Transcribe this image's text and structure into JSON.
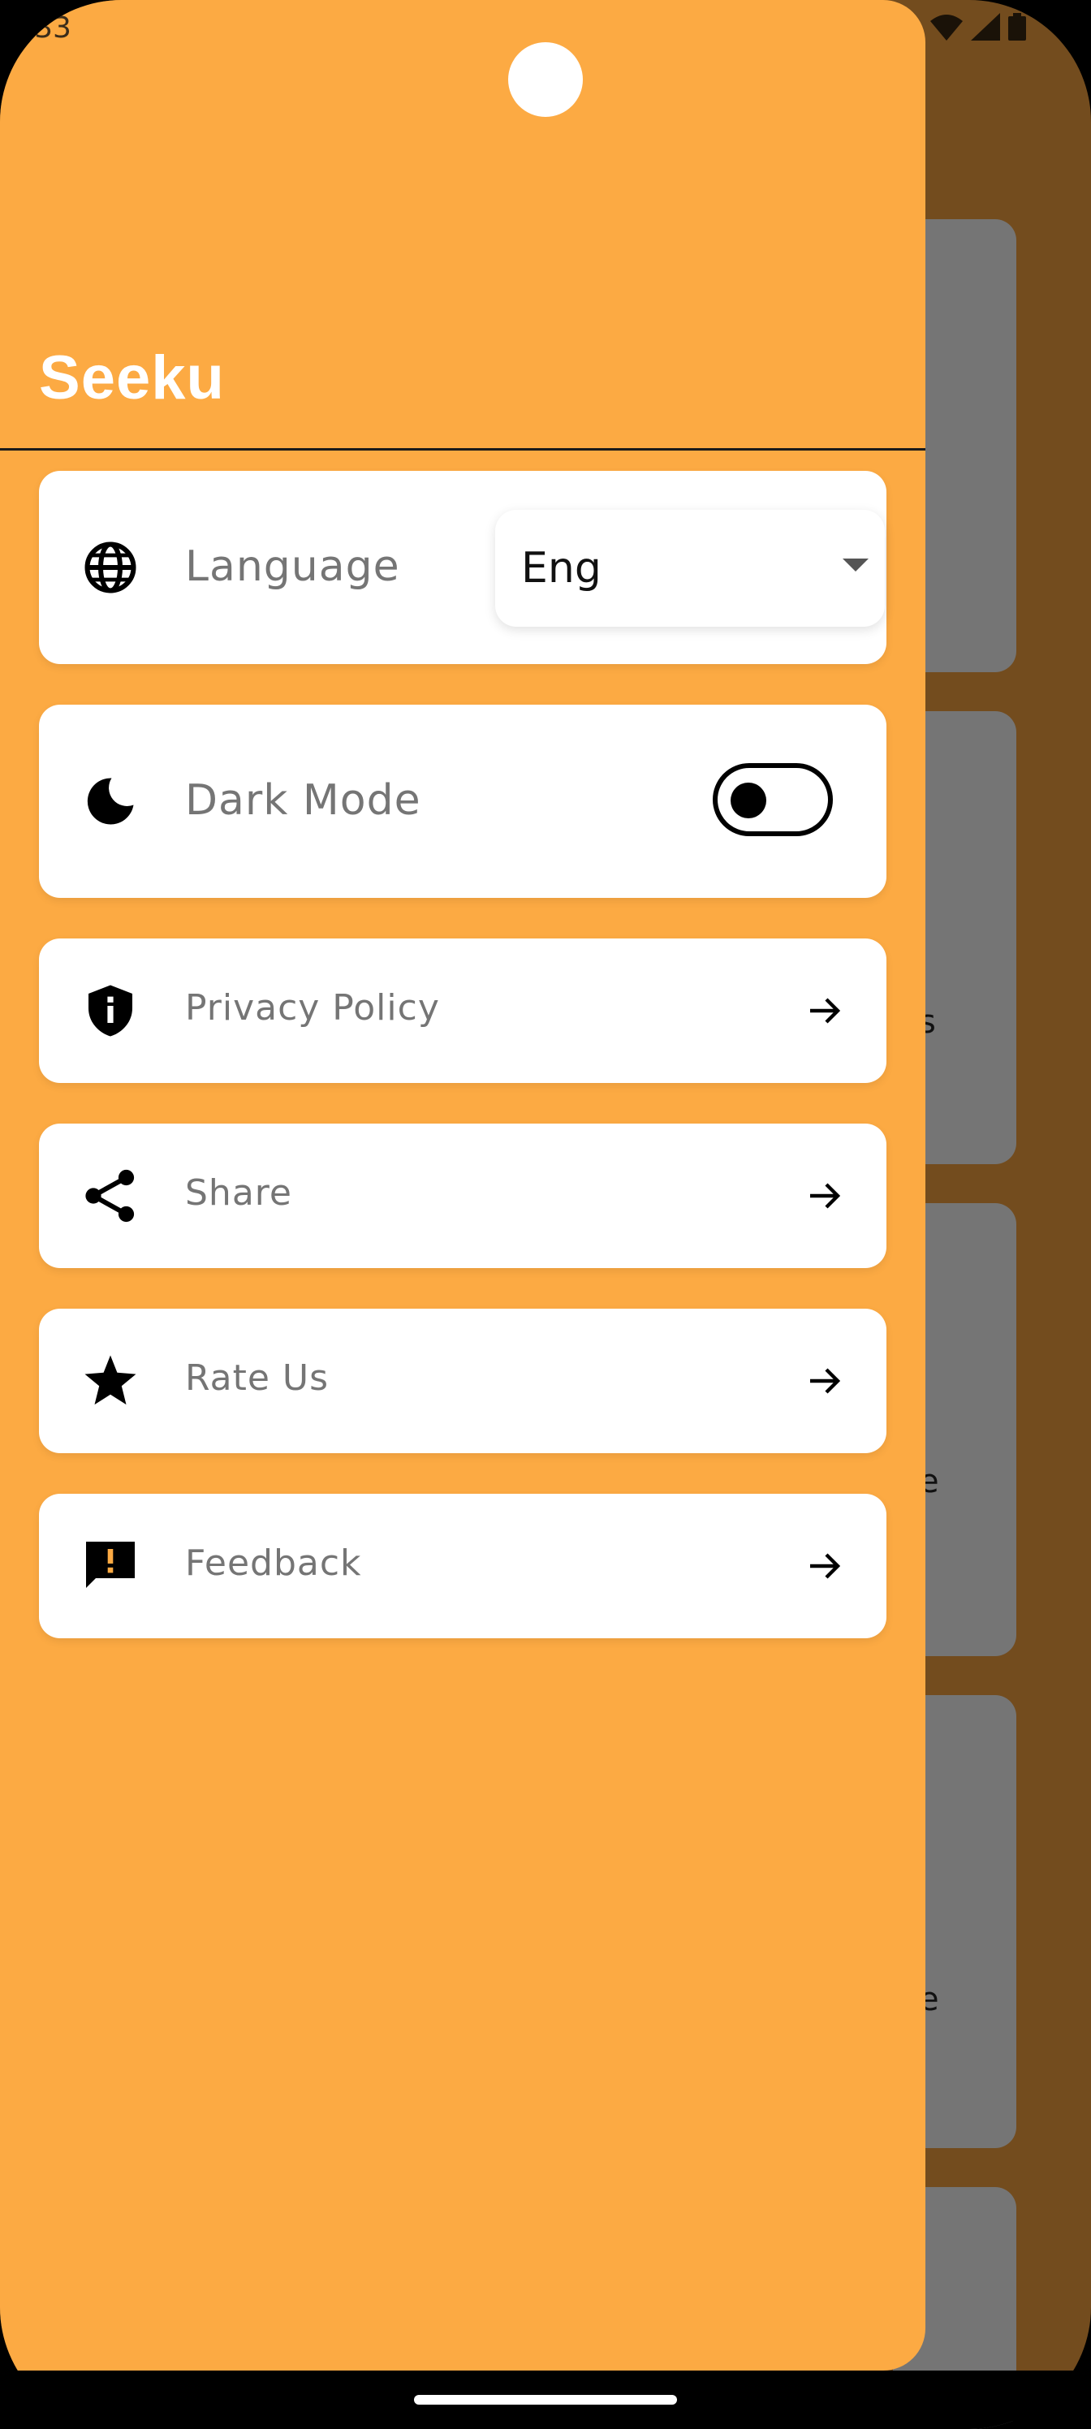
{
  "status_bar": {
    "time": ":33"
  },
  "drawer": {
    "title": "Seeku",
    "language": {
      "label": "Language",
      "value": "Eng"
    },
    "dark_mode": {
      "label": "Dark Mode",
      "enabled": false
    },
    "items": [
      {
        "label": "Privacy Policy",
        "icon": "privacy-shield-icon"
      },
      {
        "label": "Share",
        "icon": "share-icon"
      },
      {
        "label": "Rate Us",
        "icon": "star-icon"
      },
      {
        "label": "Feedback",
        "icon": "feedback-icon"
      }
    ]
  },
  "background": {
    "partial_texts": [
      "s",
      "e",
      "e"
    ]
  },
  "colors": {
    "drawer": "#FCAA43",
    "scrim": "#734C1E",
    "card": "#FFFFFF",
    "label": "#757575"
  }
}
